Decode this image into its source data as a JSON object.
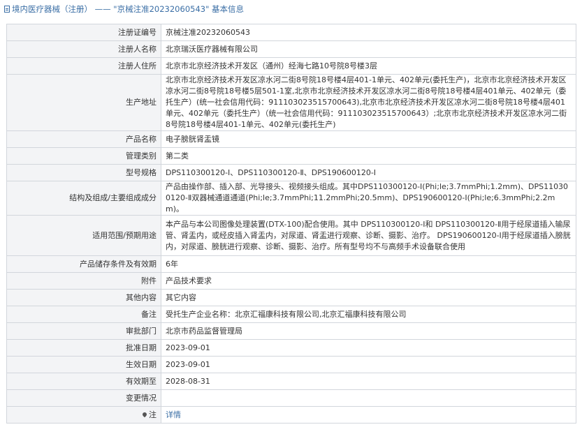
{
  "header": {
    "title": "境内医疗器械（注册） —— \"京械注准20232060543\" 基本信息"
  },
  "rows": [
    {
      "label": "注册证编号",
      "value": "京械注准20232060543"
    },
    {
      "label": "注册人名称",
      "value": "北京瑞沃医疗器械有限公司"
    },
    {
      "label": "注册人住所",
      "value": "北京市北京经济技术开发区（通州）经海七路10号院8号楼3层"
    },
    {
      "label": "生产地址",
      "value": "北京市北京经济技术开发区凉水河二街8号院18号楼4层401-1单元、402单元(委托生产)，北京市北京经济技术开发区凉水河二街8号院18号楼5层501-1室,北京市北京经济技术开发区凉水河二街8号院18号楼4层401单元、402单元（委托生产）(统一社会信用代码：911103023515700643),北京市北京经济技术开发区凉水河二街8号院18号楼4层401单元、402单元（委托生产）（统一社会信用代码：911103023515700643）;北京市北京经济技术开发区凉水河二街8号院18号楼4层401-1单元、402单元(委托生产)"
    },
    {
      "label": "产品名称",
      "value": "电子膀胱肾盂镜"
    },
    {
      "label": "管理类别",
      "value": "第二类"
    },
    {
      "label": "型号规格",
      "value": "DPS110300120-Ⅰ、DPS110300120-Ⅱ、DPS190600120-Ⅰ"
    },
    {
      "label": "结构及组成/主要组成成分",
      "value": "产品由操作部、插入部、光导接头、视频接头组成。其中DPS110300120-Ⅰ(Phi;le;3.7mmPhi;1.2mm)、DPS110300120-Ⅱ双器械通道通道(Phi;le;3.7mmPhi;11.2mmPhi;20.5mm)、DPS190600120-Ⅰ(Phi;le;6.3mmPhi;2.2mm)。"
    },
    {
      "label": "适用范围/预期用途",
      "value": "本产品与本公司图像处理装置(DTX-100)配合使用。其中 DPS110300120-Ⅰ和 DPS110300120-Ⅱ用于经尿道插入输尿管、肾盂内，或经皮插入肾盂内，对尿道、肾盂进行观察、诊断、摄影、治疗。 DPS190600120-Ⅰ用于经尿道插入膀胱内，对尿道、膀胱进行观察、诊断、摄影、治疗。所有型号均不与高频手术设备联合使用"
    },
    {
      "label": "产品储存条件及有效期",
      "value": "6年"
    },
    {
      "label": "附件",
      "value": "产品技术要求"
    },
    {
      "label": "其他内容",
      "value": "其它内容"
    },
    {
      "label": "备注",
      "value": "受托生产企业名称：北京汇福康科技有限公司,北京汇福康科技有限公司"
    },
    {
      "label": "审批部门",
      "value": "北京市药品监督管理局"
    },
    {
      "label": "批准日期",
      "value": "2023-09-01"
    },
    {
      "label": "生效日期",
      "value": "2023-09-01"
    },
    {
      "label": "有效期至",
      "value": "2028-08-31"
    },
    {
      "label": "变更情况",
      "value": ""
    },
    {
      "label": "注",
      "value": "详情"
    }
  ]
}
